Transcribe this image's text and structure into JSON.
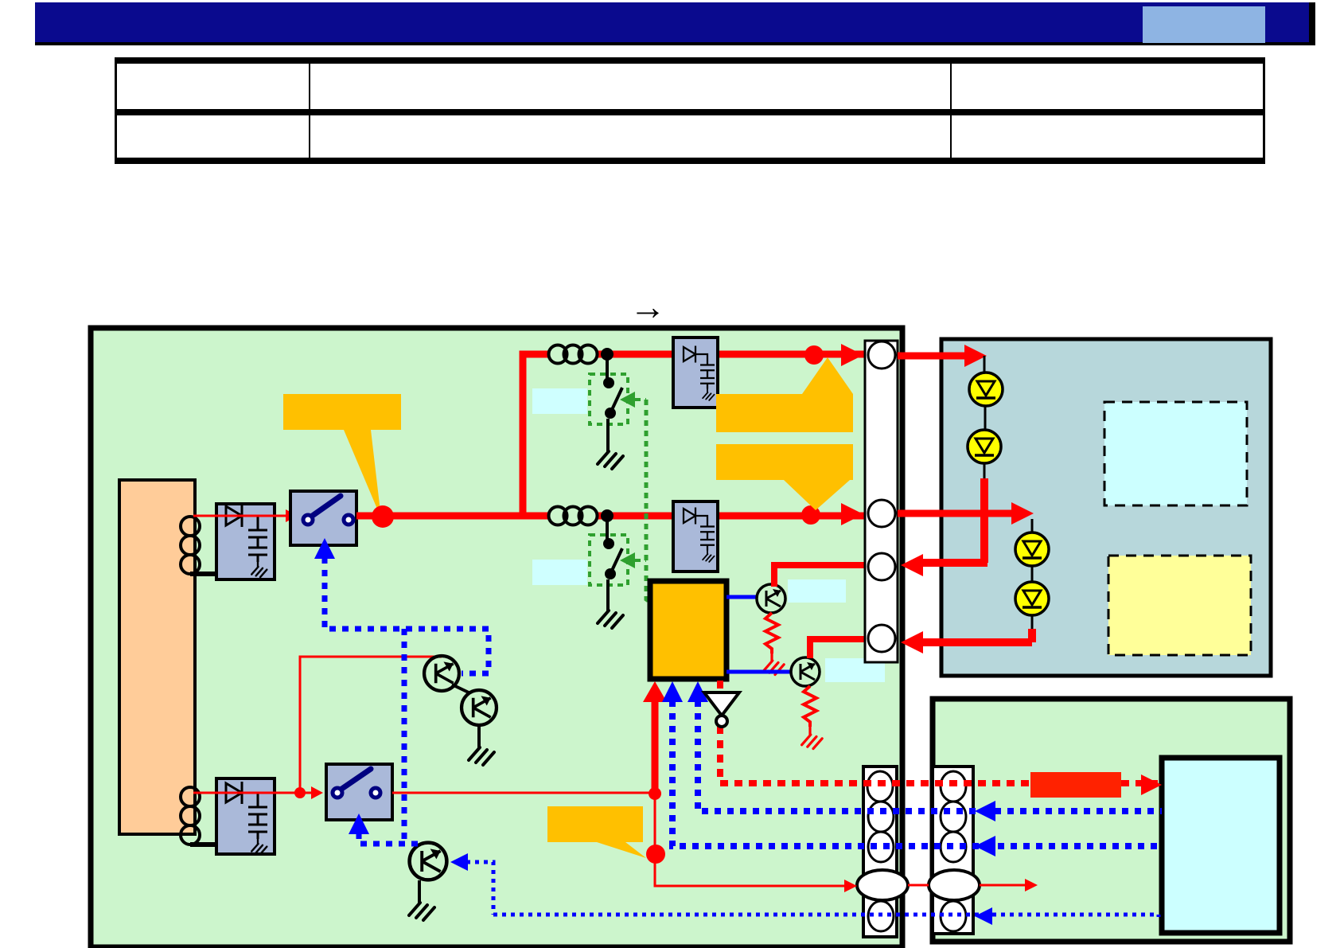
{
  "annotations": {
    "flow_arrow": "→"
  },
  "header": {
    "title_text": ""
  },
  "table": {
    "rows": [
      {
        "cells": [
          "",
          "",
          ""
        ]
      },
      {
        "cells": [
          "",
          "",
          ""
        ]
      }
    ]
  },
  "palette": {
    "navy": "#0a0a8e",
    "accent": "#8eb4e3",
    "board-green": "#ccf5cc",
    "panel-blue": "#b7d7db",
    "peach": "#ffcc99",
    "module-blue": "#aab9d9",
    "orange": "#ffc000",
    "red": "#ff0000",
    "blue": "#0000ff",
    "relay-green": "#2fa02f",
    "switch-navy": "#000080",
    "led-yellow": "#ffff00",
    "label-cyan": "#cfffff",
    "ecu-cyan": "#ccffff",
    "pale-yellow": "#ffff99",
    "label-red": "#ff2200"
  },
  "diagram": {
    "components": [
      "power-transformer",
      "rectifier-filter-1",
      "rectifier-filter-2",
      "rectifier-filter-3",
      "rectifier-filter-4",
      "power-switch-1",
      "power-switch-2",
      "relay-contact-1",
      "relay-contact-2",
      "noise-coil-1",
      "noise-coil-2",
      "control-ic",
      "driver-transistor-1",
      "driver-transistor-2",
      "transistor-pair",
      "npn-transistor",
      "inverter-gate",
      "led-lamp-1",
      "led-lamp-2",
      "led-lamp-3",
      "led-lamp-4",
      "connector-top",
      "connector-bottom-left",
      "connector-bottom-right",
      "ecu-unit",
      "signal-label"
    ]
  }
}
